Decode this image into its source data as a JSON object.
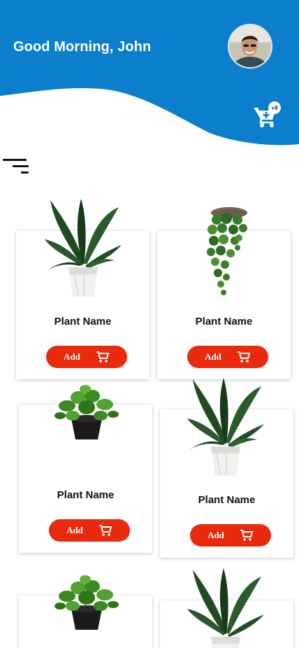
{
  "header": {
    "greeting": "Good Morning, John",
    "avatar_icon": "user-avatar",
    "background_color": "#0b7fcc"
  },
  "cart": {
    "icon": "cart-plus-icon",
    "badge": "+9"
  },
  "menu": {
    "icon": "filter-menu-icon"
  },
  "products": [
    {
      "name": "Plant Name",
      "add_label": "Add",
      "image": "potted-bird-of-paradise"
    },
    {
      "name": "Plant Name",
      "add_label": "Add",
      "image": "hanging-pothos"
    },
    {
      "name": "Plant Name",
      "add_label": "Add",
      "image": "pothos-black-pot"
    },
    {
      "name": "Plant Name",
      "add_label": "Add",
      "image": "potted-bird-of-paradise"
    },
    {
      "name": "",
      "add_label": "",
      "image": "pothos-black-pot"
    },
    {
      "name": "",
      "add_label": "",
      "image": "potted-bird-of-paradise"
    }
  ],
  "colors": {
    "primary": "#0b7fcc",
    "button": "#ea2a0c"
  }
}
